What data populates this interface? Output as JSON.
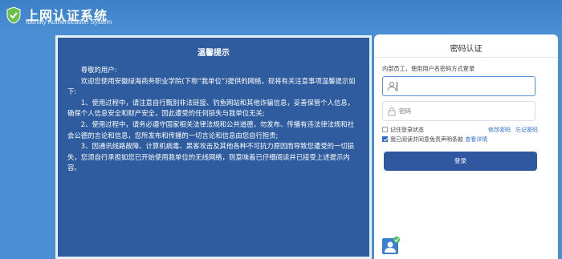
{
  "header": {
    "title": "上网认证系统",
    "subtitle": "Identity Authentication System"
  },
  "notice": {
    "title": "温馨提示",
    "greeting": "尊敬的用户:",
    "intro": "欢迎您使用安徽绿海商务职业学院(下称“我单位”)提供的网络，现将有关注意事项温馨提示如下:",
    "items": [
      "1、使用过程中，请注意自行甄别非法链接、钓鱼网站和其他诈骗信息，妥善保管个人信息，确保个人信息安全和财产安全，因此遭受的任何损失与我单位无关;",
      "2、使用过程中，请务必遵守国家相关法律法规和公共道德，勿发布、传播有违法律法规和社会公德的言论和信息，您所发布和传播的一切言论和信息由您自行担责;",
      "3、因通讯线路故障、计算机病毒、黑客攻击及其他各种不可抗力原因而导致您遭受的一切损失，您须自行承担如您已开始使用我单位的无线网络，则意味着已仔细阅读并已接受上述提示内容。"
    ]
  },
  "login": {
    "title": "密码认证",
    "description": "内部员工，使用用户名密码方式登录",
    "username_placeholder": "",
    "password_placeholder": "密码",
    "remember_label": "记住登录状态",
    "remember_checked": false,
    "modify_password": "修改密码",
    "forgot_password": "忘记密码",
    "agree_label": "我已阅读并同意免责声明条款",
    "agree_checked": true,
    "view_details": "查看详情",
    "submit_label": "登录"
  },
  "colors": {
    "background": "#4a8fd3",
    "notice_bg": "#2e5c9e",
    "button": "#2f58a0",
    "link": "#2e6fd0"
  },
  "icons": {
    "logo": "shield-check-icon",
    "user": "user-icon",
    "password": "lock-icon",
    "avatar": "user-avatar-check-icon"
  }
}
